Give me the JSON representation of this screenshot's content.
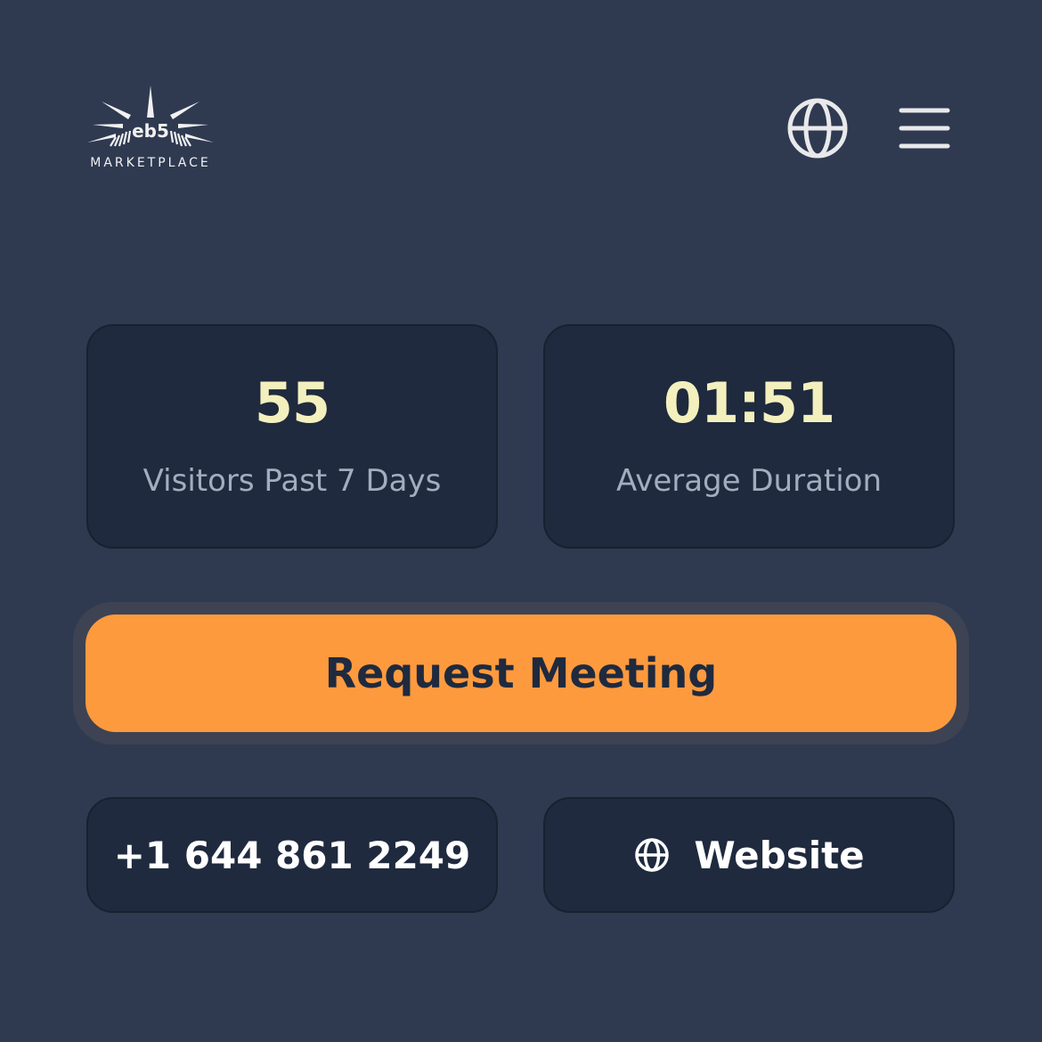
{
  "header": {
    "logo": {
      "mark": "eb5",
      "text": "MARKETPLACE"
    },
    "language_icon": "globe-icon",
    "menu_icon": "hamburger-menu-icon"
  },
  "stats": [
    {
      "value": "55",
      "label": "Visitors Past 7 Days"
    },
    {
      "value": "01:51",
      "label": "Average Duration"
    }
  ],
  "cta": {
    "label": "Request Meeting"
  },
  "contacts": {
    "phone": "+1 644 861 2249",
    "website_label": "Website",
    "website_icon": "globe-icon"
  },
  "colors": {
    "background": "#2f3a51",
    "card": "#1f2a3e",
    "accent": "#fe9a3e",
    "stat_value": "#f3f0be",
    "stat_label": "#a3adbe"
  }
}
